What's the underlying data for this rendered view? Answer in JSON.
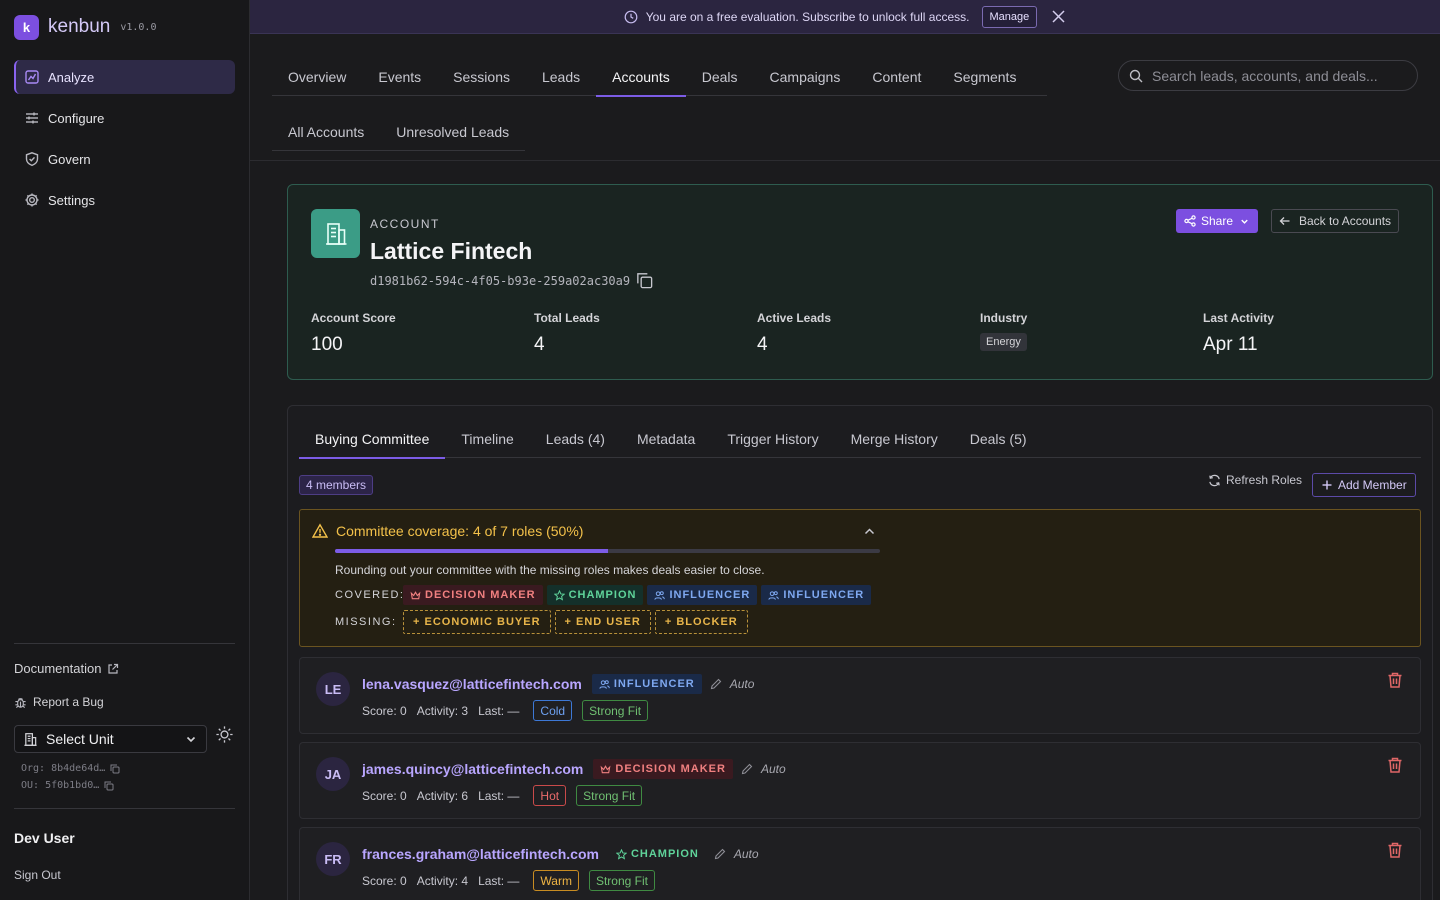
{
  "brand": {
    "logo_glyph": "k",
    "name": "kenbun",
    "version": "v1.0.0"
  },
  "sidebar": {
    "nav": [
      {
        "label": "Analyze",
        "icon": "analyze-icon",
        "active": true
      },
      {
        "label": "Configure",
        "icon": "sliders-icon"
      },
      {
        "label": "Govern",
        "icon": "shield-icon"
      },
      {
        "label": "Settings",
        "icon": "gear-icon"
      }
    ],
    "documentation": "Documentation",
    "report_bug": "Report a Bug",
    "unit_select": "Select Unit",
    "org": "Org: 8b4de64d…",
    "ou": "OU: 5f0b1bd0…",
    "user": "Dev User",
    "sign_out": "Sign Out"
  },
  "banner": {
    "message": "You are on a free evaluation. Subscribe to unlock full access.",
    "manage": "Manage"
  },
  "top_tabs": [
    "Overview",
    "Events",
    "Sessions",
    "Leads",
    "Accounts",
    "Deals",
    "Campaigns",
    "Content",
    "Segments"
  ],
  "top_tabs_active": "Accounts",
  "search": {
    "placeholder": "Search leads, accounts, and deals..."
  },
  "sub_tabs": [
    "All Accounts",
    "Unresolved Leads"
  ],
  "account": {
    "kicker": "ACCOUNT",
    "name": "Lattice Fintech",
    "id": "d1981b62-594c-4f05-b93e-259a02ac30a9",
    "share": "Share",
    "back": "Back to Accounts",
    "stats": {
      "score_label": "Account Score",
      "score": "100",
      "total_label": "Total Leads",
      "total": "4",
      "active_label": "Active Leads",
      "active": "4",
      "industry_label": "Industry",
      "industry": "Energy",
      "last_label": "Last Activity",
      "last": "Apr 11"
    }
  },
  "detail_tabs": [
    "Buying Committee",
    "Timeline",
    "Leads (4)",
    "Metadata",
    "Trigger History",
    "Merge History",
    "Deals (5)"
  ],
  "detail_tabs_active": "Buying Committee",
  "committee": {
    "members_badge": "4 members",
    "refresh": "Refresh Roles",
    "add_member": "Add Member",
    "coverage_title": "Committee coverage: 4 of 7 roles (50%)",
    "coverage_fraction": 0.5,
    "note": "Rounding out your committee with the missing roles makes deals easier to close.",
    "covered_label": "COVERED:",
    "covered": [
      "DECISION MAKER",
      "CHAMPION",
      "INFLUENCER",
      "INFLUENCER"
    ],
    "missing_label": "MISSING:",
    "missing": [
      "+ ECONOMIC BUYER",
      "+ END USER",
      "+ BLOCKER"
    ],
    "members": [
      {
        "initials": "LE",
        "email": "lena.vasquez@latticefintech.com",
        "role": "INFLUENCER",
        "auto": "Auto",
        "score": "Score: 0",
        "activity": "Activity: 3",
        "last": "Last: —",
        "temp": "Cold",
        "fit": "Strong Fit"
      },
      {
        "initials": "JA",
        "email": "james.quincy@latticefintech.com",
        "role": "DECISION MAKER",
        "auto": "Auto",
        "score": "Score: 0",
        "activity": "Activity: 6",
        "last": "Last: —",
        "temp": "Hot",
        "fit": "Strong Fit"
      },
      {
        "initials": "FR",
        "email": "frances.graham@latticefintech.com",
        "role": "CHAMPION",
        "auto": "Auto",
        "score": "Score: 0",
        "activity": "Activity: 4",
        "last": "Last: —",
        "temp": "Warm",
        "fit": "Strong Fit"
      }
    ]
  },
  "colors": {
    "accent": "#7c4fe0",
    "account_card": "#3b9c86",
    "warning": "#f3c14a"
  }
}
